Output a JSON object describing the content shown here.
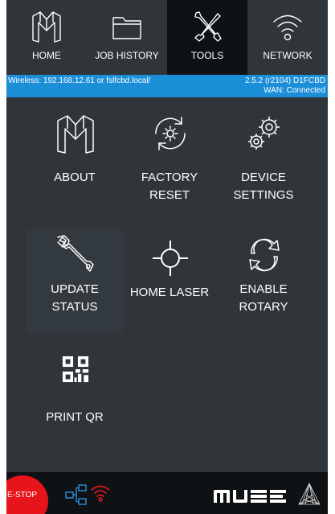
{
  "nav": {
    "items": [
      {
        "label": "HOME",
        "icon": "muse-logo-icon"
      },
      {
        "label": "JOB HISTORY",
        "icon": "folder-icon"
      },
      {
        "label": "TOOLS",
        "icon": "tools-icon"
      },
      {
        "label": "NETWORK",
        "icon": "wifi-icon"
      }
    ],
    "active": "TOOLS"
  },
  "status": {
    "wireless": "Wireless: 192.168.12.61  or fslfcbd.local/",
    "version": "2.5.2 (r2104)  D1FCBD",
    "wan": "WAN: Connected"
  },
  "tools": [
    {
      "line1": "ABOUT",
      "line2": "",
      "icon": "muse-logo-icon"
    },
    {
      "line1": "FACTORY",
      "line2": "RESET",
      "icon": "factory-reset-icon"
    },
    {
      "line1": "DEVICE",
      "line2": "SETTINGS",
      "icon": "gears-icon"
    },
    {
      "line1": "UPDATE",
      "line2": "STATUS",
      "icon": "wrench-icon"
    },
    {
      "line1": "HOME LASER",
      "line2": "",
      "icon": "crosshair-icon"
    },
    {
      "line1": "ENABLE",
      "line2": "ROTARY",
      "icon": "rotary-icon"
    },
    {
      "line1": "PRINT QR",
      "line2": "",
      "icon": "qr-code-icon"
    }
  ],
  "bottom": {
    "estop": "E-STOP",
    "brand": "muse"
  },
  "colors": {
    "background": "#2f3539",
    "nav_active": "#0f1214",
    "status_bar": "#1b8ed8",
    "estop": "#e8141b"
  }
}
